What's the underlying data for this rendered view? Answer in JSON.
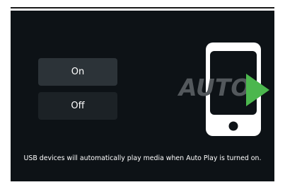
{
  "options": {
    "on_label": "On",
    "off_label": "Off",
    "selected": "On"
  },
  "logo": {
    "text": "AUTO",
    "icon": "auto-play-phone-icon",
    "colors": {
      "phone": "#ffffff",
      "text": "#53585c",
      "play": "#4cb74e"
    }
  },
  "caption": "USB devices will automatically play media when Auto Play is turned on.",
  "colors": {
    "screen_background": "#0d1216",
    "button_selected": "#2c3338",
    "button_unselected": "#1c2226"
  }
}
